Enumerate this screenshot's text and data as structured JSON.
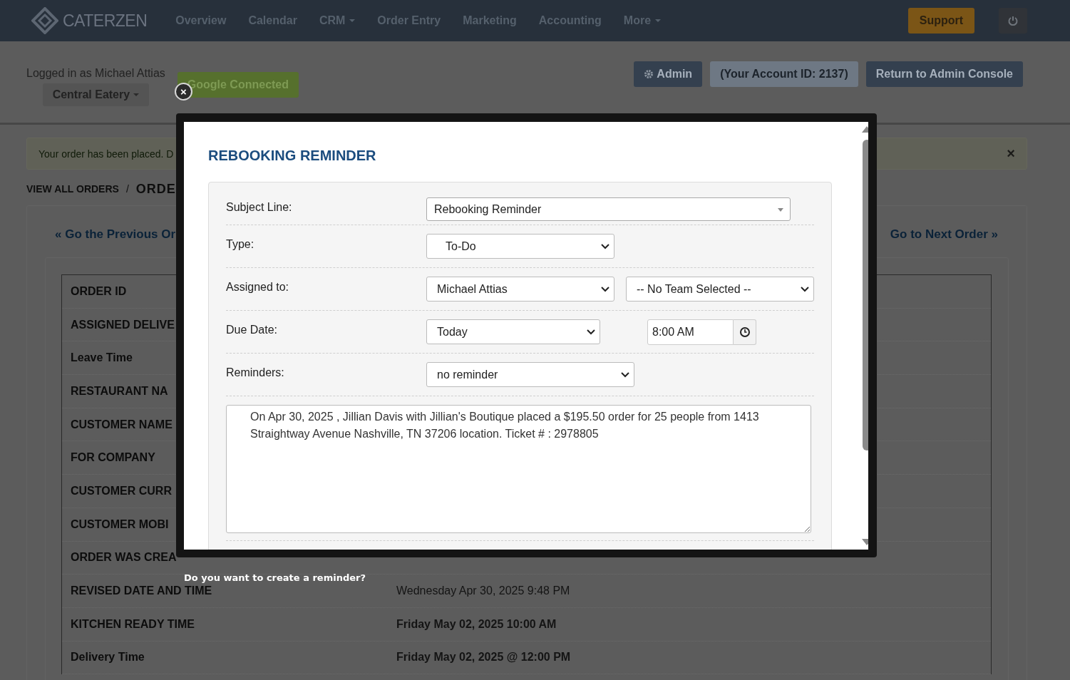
{
  "nav": {
    "logo": "CATERZEN",
    "items": [
      {
        "label": "Overview",
        "dropdown": false
      },
      {
        "label": "Calendar",
        "dropdown": false
      },
      {
        "label": "CRM",
        "dropdown": true
      },
      {
        "label": "Order Entry",
        "dropdown": false
      },
      {
        "label": "Marketing",
        "dropdown": false
      },
      {
        "label": "Accounting",
        "dropdown": false
      },
      {
        "label": "More",
        "dropdown": true
      }
    ],
    "support": "Support"
  },
  "account": {
    "logged_in": "Logged in as Michael Attias",
    "location": "Central Eatery",
    "google": "Google Connected",
    "admin": "Admin",
    "account_id": "(Your Account ID: 2137)",
    "return": "Return to Admin Console"
  },
  "alert": {
    "text": "Your order has been placed. D",
    "close": "×"
  },
  "breadcrumb": {
    "link": "VIEW ALL ORDERS",
    "separator": "/",
    "current": "ORDE"
  },
  "pager": {
    "previous": "« Go the Previous Or",
    "next": "Go to Next Order »"
  },
  "order_rows": [
    {
      "label": "ORDER ID"
    },
    {
      "label": "ASSIGNED DELIVE"
    },
    {
      "label": "Leave Time"
    },
    {
      "label": "RESTAURANT NA"
    },
    {
      "label": "CUSTOMER NAME"
    },
    {
      "label": "FOR COMPANY"
    },
    {
      "label": "CUSTOMER CURR"
    },
    {
      "label": "CUSTOMER MOBI"
    },
    {
      "label": "ORDER WAS CREA"
    },
    {
      "label": "REVISED DATE AND TIME",
      "value": "Wednesday Apr 30, 2025 9:48 PM",
      "bold": false
    },
    {
      "label": "KITCHEN READY TIME",
      "value": "Friday May 02, 2025 10:00 AM",
      "bold": true
    },
    {
      "label": "Delivery Time",
      "value": "Friday May 02, 2025 @ 12:00 PM",
      "bold": true
    }
  ],
  "prompt": "Do you want to create a reminder?",
  "modal": {
    "title": "REBOOKING REMINDER",
    "close": "×",
    "subject": {
      "label": "Subject Line:",
      "value": "Rebooking Reminder"
    },
    "type": {
      "label": "Type:",
      "value": "To-Do"
    },
    "assigned": {
      "label": "Assigned to:",
      "user": "Michael Attias",
      "team": "-- No Team Selected --"
    },
    "due": {
      "label": "Due Date:",
      "date": "Today",
      "time": "8:00 AM"
    },
    "reminders": {
      "label": "Reminders:",
      "value": "no reminder"
    },
    "message": "On Apr 30, 2025 , Jillian Davis with Jillian's Boutique placed a $195.50 order for 25 people from 1413 Straightway Avenue Nashville, TN 37206 location. Ticket # : 2978805"
  }
}
